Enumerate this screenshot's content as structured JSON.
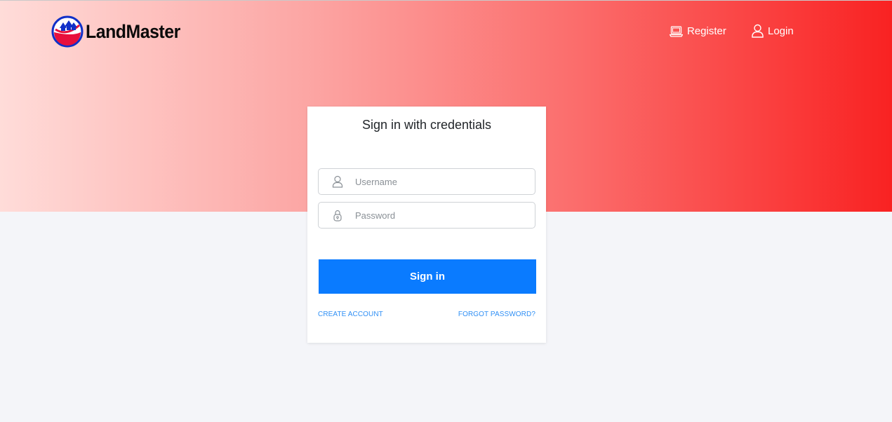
{
  "brand": {
    "name": "LandMaster",
    "logo_icon": "house-circle-logo"
  },
  "nav": {
    "register_label": "Register",
    "register_icon": "laptop-icon",
    "login_label": "Login",
    "login_icon": "user-icon"
  },
  "login_card": {
    "title": "Sign in with credentials",
    "username": {
      "placeholder": "Username",
      "value": "",
      "icon": "user-icon"
    },
    "password": {
      "placeholder": "Password",
      "value": "",
      "icon": "lock-icon"
    },
    "submit_label": "Sign in",
    "create_account_label": "CREATE ACCOUNT",
    "forgot_password_label": "FORGOT PASSWORD?"
  },
  "colors": {
    "hero_gradient_start": "#ffdcd9",
    "hero_gradient_end": "#f92222",
    "primary_button": "#0a7bff",
    "link": "#2f8ff5",
    "page_background": "#f4f5f9"
  }
}
